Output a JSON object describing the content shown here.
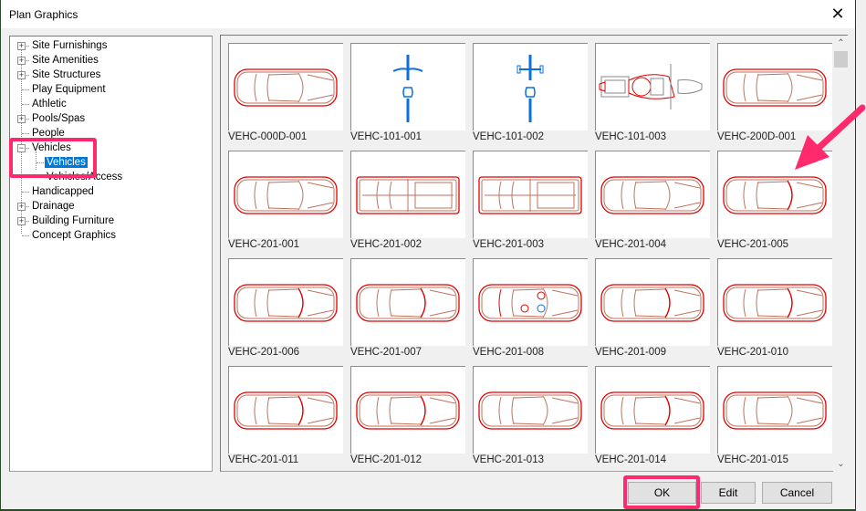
{
  "window": {
    "title": "Plan Graphics",
    "close_label": "✕"
  },
  "tree": {
    "items": [
      {
        "label": "Site Furnishings",
        "expander": "+",
        "level": 0
      },
      {
        "label": "Site Amenities",
        "expander": "+",
        "level": 0
      },
      {
        "label": "Site Structures",
        "expander": "+",
        "level": 0
      },
      {
        "label": "Play Equipment",
        "expander": "",
        "level": 0
      },
      {
        "label": "Athletic",
        "expander": "",
        "level": 0
      },
      {
        "label": "Pools/Spas",
        "expander": "+",
        "level": 0
      },
      {
        "label": "People",
        "expander": "",
        "level": 0
      },
      {
        "label": "Vehicles",
        "expander": "−",
        "level": 0
      },
      {
        "label": "Vehicles",
        "expander": "",
        "level": 1,
        "selected": true
      },
      {
        "label": "Vehicles/Access",
        "expander": "",
        "level": 1
      },
      {
        "label": "Handicapped",
        "expander": "",
        "level": 0
      },
      {
        "label": "Drainage",
        "expander": "+",
        "level": 0
      },
      {
        "label": "Building Furniture",
        "expander": "+",
        "level": 0
      },
      {
        "label": "Concept Graphics",
        "expander": "",
        "level": 0
      }
    ]
  },
  "gallery": {
    "tiles": [
      {
        "label": "VEHC-000D-001",
        "icon": "car-icon"
      },
      {
        "label": "VEHC-101-001",
        "icon": "bicycle-icon"
      },
      {
        "label": "VEHC-101-002",
        "icon": "bicycle-icon"
      },
      {
        "label": "VEHC-101-003",
        "icon": "motorcycle-icon"
      },
      {
        "label": "VEHC-200D-001",
        "icon": "car-icon"
      },
      {
        "label": "VEHC-201-001",
        "icon": "car-icon"
      },
      {
        "label": "VEHC-201-002",
        "icon": "truck-icon"
      },
      {
        "label": "VEHC-201-003",
        "icon": "truck-icon"
      },
      {
        "label": "VEHC-201-004",
        "icon": "car-icon"
      },
      {
        "label": "VEHC-201-005",
        "icon": "car-icon"
      },
      {
        "label": "VEHC-201-006",
        "icon": "car-icon"
      },
      {
        "label": "VEHC-201-007",
        "icon": "car-icon"
      },
      {
        "label": "VEHC-201-008",
        "icon": "convertible-icon"
      },
      {
        "label": "VEHC-201-009",
        "icon": "car-icon"
      },
      {
        "label": "VEHC-201-010",
        "icon": "car-icon"
      },
      {
        "label": "VEHC-201-011",
        "icon": "car-icon"
      },
      {
        "label": "VEHC-201-012",
        "icon": "car-icon"
      },
      {
        "label": "VEHC-201-013",
        "icon": "car-icon"
      },
      {
        "label": "VEHC-201-014",
        "icon": "car-icon"
      },
      {
        "label": "VEHC-201-015",
        "icon": "car-icon"
      }
    ]
  },
  "scrollbar": {
    "up_icon": "⌃",
    "down_icon": "⌄"
  },
  "buttons": {
    "ok": "OK",
    "edit": "Edit",
    "cancel": "Cancel"
  },
  "colors": {
    "accent_selection": "#0078d7",
    "annotation": "#ff2a6d",
    "drawing_red": "#e00000",
    "drawing_brown": "#c0735c",
    "drawing_blue": "#0a6fe0"
  }
}
